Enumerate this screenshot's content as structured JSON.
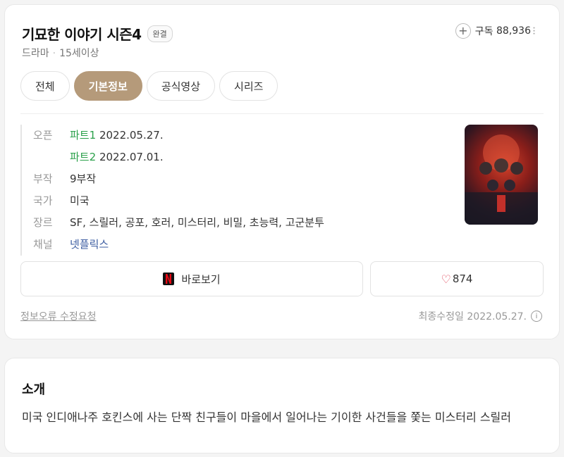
{
  "header": {
    "title": "기묘한 이야기 시즌4",
    "badge": "완결",
    "genre": "드라마",
    "rating": "15세이상",
    "subscribe_label": "구독",
    "subscribe_count": "88,936"
  },
  "tabs": [
    {
      "label": "전체",
      "active": false
    },
    {
      "label": "기본정보",
      "active": true
    },
    {
      "label": "공식영상",
      "active": false
    },
    {
      "label": "시리즈",
      "active": false
    }
  ],
  "info": {
    "open_key": "오픈",
    "part1_label": "파트1",
    "part1_date": "2022.05.27.",
    "part2_label": "파트2",
    "part2_date": "2022.07.01.",
    "episodes_key": "부작",
    "episodes_value": "9부작",
    "country_key": "국가",
    "country_value": "미국",
    "genre_key": "장르",
    "genre_value": "SF, 스릴러, 공포, 호러, 미스터리, 비밀, 초능력, 고군분투",
    "channel_key": "채널",
    "channel_value": "넷플릭스"
  },
  "actions": {
    "watch_label": "바로보기",
    "like_count": "874"
  },
  "footer": {
    "report_link": "정보오류 수정요청",
    "last_modified": "최종수정일 2022.05.27."
  },
  "intro": {
    "title": "소개",
    "text": "미국 인디애나주 호킨스에 사는 단짝 친구들이 마을에서 일어나는 기이한 사건들을 쫓는 미스터리 스릴러"
  },
  "colors": {
    "accent": "#b59a7a",
    "part_green": "#2aa04a",
    "channel_link": "#3a5ba0",
    "heart": "#e0485a"
  }
}
